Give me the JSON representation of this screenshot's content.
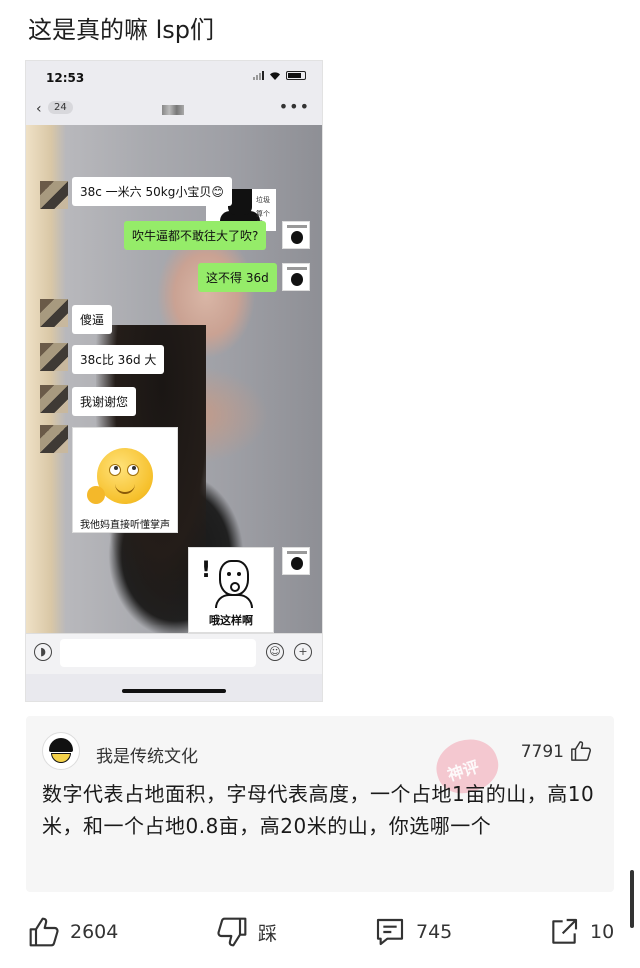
{
  "post": {
    "title": "这是真的嘛 lsp们"
  },
  "screenshot": {
    "status_time": "12:53",
    "unread_count": "24",
    "more_icon": "more-icon",
    "messages": [
      {
        "side": "left",
        "text": "38c 一米六 50kg小宝贝😊"
      },
      {
        "side": "right",
        "text": "吹牛逼都不敢往大了吹?"
      },
      {
        "side": "right",
        "text": "这不得 36d"
      },
      {
        "side": "left",
        "text": "傻逼"
      },
      {
        "side": "left",
        "text": "38c比 36d 大"
      },
      {
        "side": "left",
        "text": "我谢谢您"
      }
    ],
    "sticker_top_text_1": "垃圾",
    "sticker_top_text_2": "算个屁",
    "sticker_emoji_caption": "我他妈直接听懂掌声",
    "sticker_oh_caption": "哦这样啊"
  },
  "comment": {
    "username": "我是传统文化",
    "like_count": "7791",
    "stamp_label": "神评",
    "text": "数字代表占地面积，字母代表高度，一个占地1亩的山，高10米，和一个占地0.8亩，高20米的山，你选哪一个"
  },
  "actions": {
    "like_count": "2604",
    "dislike_label": "踩",
    "comment_count": "745",
    "share_count": "10"
  }
}
